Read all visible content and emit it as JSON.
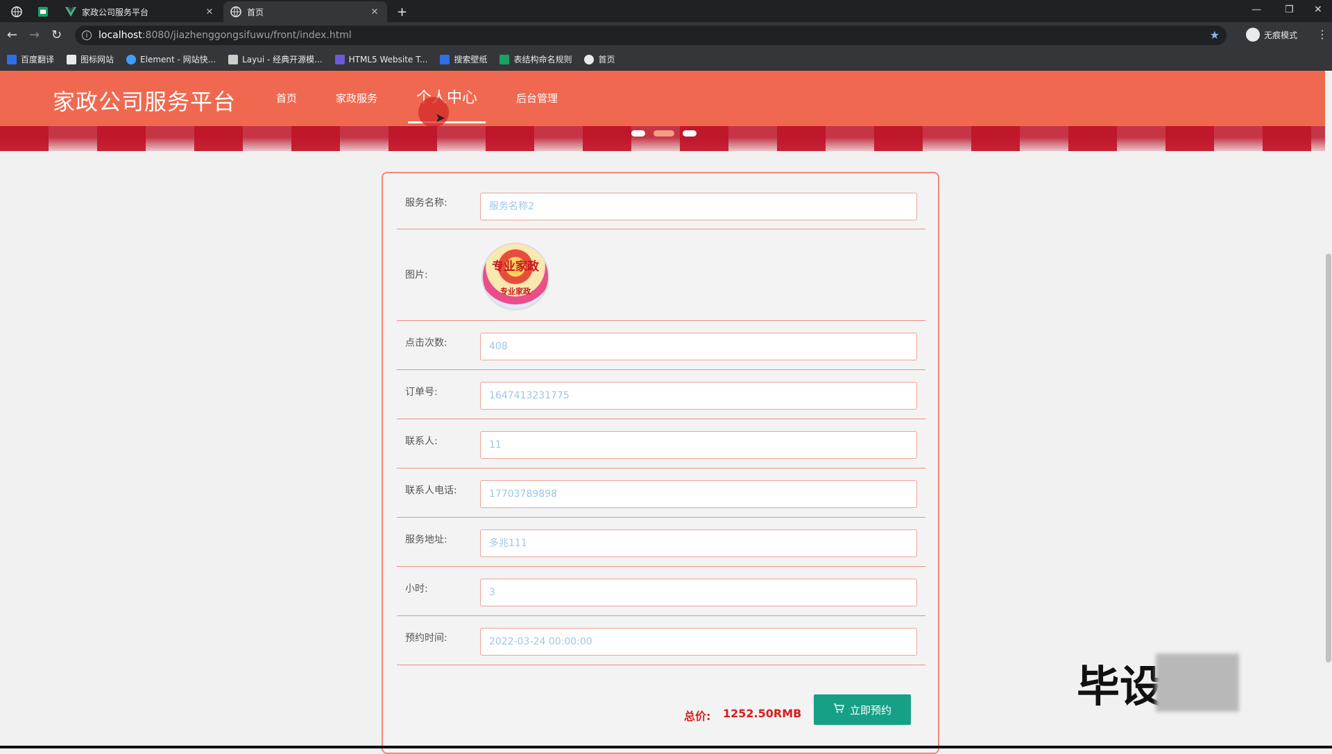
{
  "browser": {
    "tabs": [
      {
        "label": "",
        "active": false
      },
      {
        "label": "",
        "active": false
      },
      {
        "label": "家政公司服务平台",
        "active": false
      },
      {
        "label": "首页",
        "active": true
      }
    ],
    "new_tab": "+",
    "url_host": "localhost",
    "url_rest": ":8080/jiazhenggongsifuwu/front/index.html",
    "profile_label": "无痕模式",
    "bookmarks": [
      {
        "label": "百度翻译",
        "color": "#2f6ee8"
      },
      {
        "label": "图标网站",
        "color": "#e8eaed"
      },
      {
        "label": "Element - 网站快...",
        "color": "#409eff"
      },
      {
        "label": "Layui - 经典开源模...",
        "color": "#cccccc"
      },
      {
        "label": "HTML5 Website T...",
        "color": "#6b5bd6"
      },
      {
        "label": "搜索壁纸",
        "color": "#2f6ee8"
      },
      {
        "label": "表结构命名规则",
        "color": "#1aa260"
      },
      {
        "label": "首页",
        "color": "#e8eaed"
      }
    ]
  },
  "site": {
    "title": "家政公司服务平台",
    "nav": [
      {
        "label": "首页",
        "active": false
      },
      {
        "label": "家政服务",
        "active": false
      },
      {
        "label": "个人中心",
        "active": true
      },
      {
        "label": "后台管理",
        "active": false
      }
    ],
    "accent_color": "#f0684f"
  },
  "form": {
    "service_name": {
      "label": "服务名称:",
      "value": "服务名称2"
    },
    "image": {
      "label": "图片:",
      "text_top": "专业家政",
      "text_bottom": "专业家政"
    },
    "clicks": {
      "label": "点击次数:",
      "value": "408"
    },
    "order_no": {
      "label": "订单号:",
      "value": "1647413231775"
    },
    "contact": {
      "label": "联系人:",
      "value": "11"
    },
    "contact_phone": {
      "label": "联系人电话:",
      "value": "17703789898"
    },
    "address": {
      "label": "服务地址:",
      "value": "多兆111"
    },
    "hours": {
      "label": "小时:",
      "value": "3"
    },
    "appointment_time": {
      "label": "预约时间:",
      "value": "2022-03-24 00:00:00"
    }
  },
  "footer": {
    "total_label": "总价:",
    "total_value": "1252.50RMB",
    "reserve_button": "立即预约",
    "button_color": "#16a085"
  },
  "watermark": "毕设"
}
